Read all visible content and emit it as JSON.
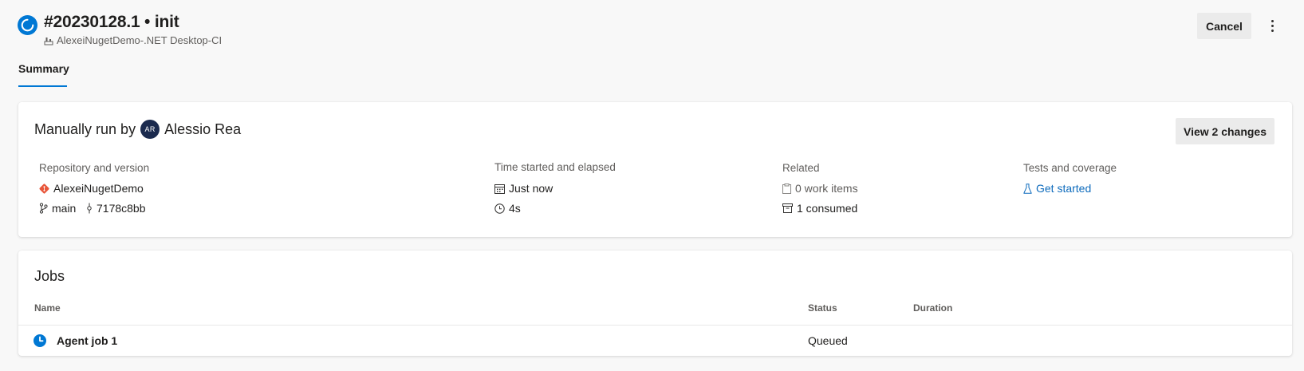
{
  "header": {
    "title": "#20230128.1 • init",
    "pipeline": "AlexeiNugetDemo-.NET Desktop-CI",
    "cancel_label": "Cancel",
    "status_icon": "in-progress-icon",
    "more_icon": "more-vertical-icon"
  },
  "tabs": [
    {
      "label": "Summary",
      "selected": true
    }
  ],
  "summary": {
    "manual_run_prefix": "Manually run by",
    "user_initials": "AR",
    "user_name": "Alessio Rea",
    "view_changes_label": "View 2 changes",
    "repository": {
      "label": "Repository and version",
      "repo_name": "AlexeiNugetDemo",
      "branch": "main",
      "commit": "7178c8bb"
    },
    "time": {
      "label": "Time started and elapsed",
      "started": "Just now",
      "elapsed": "4s"
    },
    "related": {
      "label": "Related",
      "work_items": "0 work items",
      "consumed": "1 consumed"
    },
    "tests": {
      "label": "Tests and coverage",
      "link_label": "Get started"
    }
  },
  "jobs": {
    "title": "Jobs",
    "columns": [
      "Name",
      "Status",
      "Duration"
    ],
    "rows": [
      {
        "name": "Agent job 1",
        "status": "Queued",
        "duration": ""
      }
    ]
  },
  "colors": {
    "accent": "#0078d4",
    "link": "#0f6cbd",
    "git": "#e8563a",
    "avatar": "#1b2a4e",
    "background": "#f8f8f8"
  }
}
